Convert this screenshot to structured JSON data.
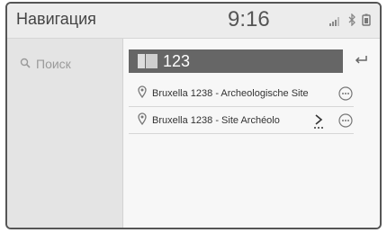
{
  "header": {
    "title": "Навигация",
    "time": "9:16",
    "icons": [
      "signal-bars-icon",
      "bluetooth-icon",
      "battery-icon"
    ]
  },
  "sidebar": {
    "search_label": "Поиск",
    "search_icon": "magnifier-icon"
  },
  "search": {
    "query": "123",
    "back_icon": "return-arrow-icon"
  },
  "results": [
    {
      "label": "Bruxella 1238 - Archeologische Site",
      "icon": "map-pin-icon",
      "action_icon": "more-options-icon"
    },
    {
      "label": "Bruxella 1238 - Site Archéolo",
      "icon": "map-pin-icon",
      "action_icon": "more-options-icon",
      "extra_icon": "navigate-arrow-icon"
    }
  ],
  "colors": {
    "query_bar": "#666666",
    "sidebar": "#e4e4e4",
    "background": "#f2f2f2"
  }
}
